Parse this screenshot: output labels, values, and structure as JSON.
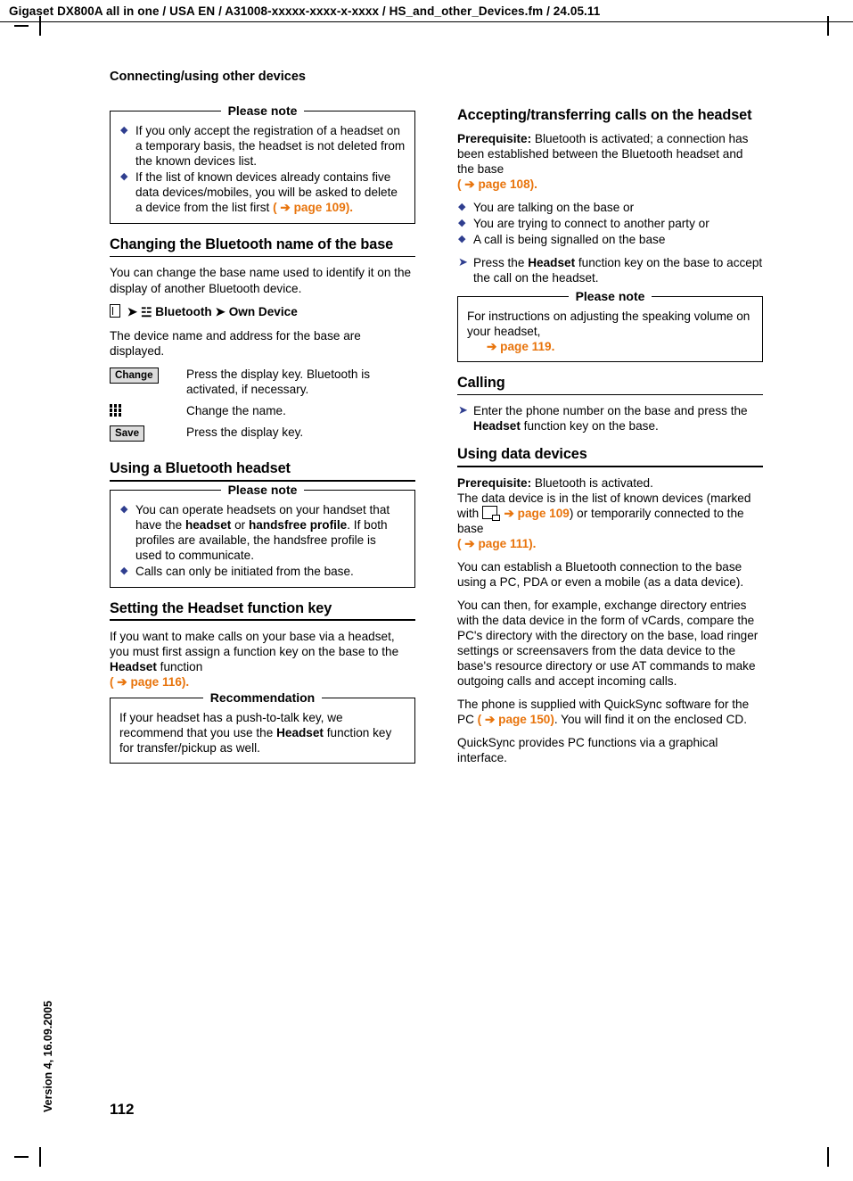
{
  "document": {
    "header": "Gigaset DX800A all in one / USA EN / A31008-xxxxx-xxxx-x-xxxx / HS_and_other_Devices.fm / 24.05.11",
    "running_head": "Connecting/using other devices",
    "page_number": "112",
    "side_version": "Version 4, 16.09.2005",
    "link_color": "#E8740C",
    "bullet_color": "#2F3E8F"
  },
  "left_column": {
    "note1": {
      "title": "Please note",
      "items": [
        "If you only accept the registration of a headset on a temporary basis, the headset is not deleted from the known devices list.",
        "If the list of known devices already contains five data devices/mobiles, you will be asked to delete a device from the list first "
      ],
      "item2_link": "( ➔ page 109)."
    },
    "section1": {
      "heading": "Changing the Bluetooth name of the base",
      "para1": "You can change the base name used to identify it on the display of another Bluetooth device.",
      "menu_path_1": "Bluetooth",
      "menu_path_2": "Own Device",
      "para2": "The device name and address for the base are displayed.",
      "steps": [
        {
          "key": "Change",
          "key_type": "display-key",
          "text": "Press the display key. Bluetooth is activated, if necessary."
        },
        {
          "key": "keypad",
          "key_type": "keypad",
          "text": "Change the name."
        },
        {
          "key": "Save",
          "key_type": "display-key",
          "text": "Press the display key."
        }
      ]
    },
    "section2": {
      "heading": "Using a Bluetooth headset",
      "note": {
        "title": "Please note",
        "item1_a": "You can operate headsets on your handset that have the ",
        "item1_b": "headset",
        "item1_c": " or ",
        "item1_d": "handsfree profile",
        "item1_e": ". If both profiles are available, the handsfree profile is used to communicate.",
        "item2": "Calls can only be initiated from the base."
      }
    },
    "section3": {
      "heading": "Setting the Headset function key",
      "para1_a": "If you want to make calls on your base via a headset, you must first assign a function key on the base to the ",
      "para1_b": "Headset",
      "para1_c": " function",
      "para1_link": "( ➔ page 116).",
      "recommendation": {
        "title": "Recommendation",
        "text_a": "If your headset has a push-to-talk key, we recommend that you use the ",
        "text_b": "Headset",
        "text_c": " function key for transfer/pickup as well."
      }
    }
  },
  "right_column": {
    "section1": {
      "heading": "Accepting/transferring calls on the headset",
      "prereq_label": "Prerequisite:",
      "prereq_text": " Bluetooth is activated; a connection has been established between the Bluetooth headset and the base",
      "prereq_link": "( ➔ page 108).",
      "bullets": [
        "You are talking on the base or",
        "You are trying to connect to another party or",
        "A call is being signalled on the base"
      ],
      "action_a": "Press the ",
      "action_b": "Headset",
      "action_c": " function key on the base to accept the call on the headset.",
      "note": {
        "title": "Please note",
        "text": "For instructions on adjusting the speaking volume on your headset,",
        "link": "➔ page 119."
      }
    },
    "section2": {
      "heading": "Calling",
      "action_a": "Enter the phone number on the base and press the ",
      "action_b": "Headset",
      "action_c": " function key on the base."
    },
    "section3": {
      "heading": "Using data devices",
      "prereq_label": "Prerequisite:",
      "prereq_text": " Bluetooth is activated.",
      "para1_a": "The data device is in the list of known devices (marked with ",
      "para1_link1": "➔  page 109",
      "para1_b": ") or temporarily connected to the base",
      "para1_link2": "( ➔  page 111).",
      "para2": "You can establish a Bluetooth connection to the base using a PC, PDA or even a mobile (as a data device).",
      "para3": "You can then, for example, exchange directory entries with the data device in the form of vCards, compare the PC's directory with the directory on the base, load ringer settings or screensavers from the data device to the base's resource directory or use AT commands to make outgoing calls and accept incoming calls.",
      "para4_a": "The phone is supplied with QuickSync software for the PC ",
      "para4_link": "( ➔  page 150)",
      "para4_b": ". You will find it on the enclosed CD.",
      "para5": "QuickSync provides PC functions via a graphical interface."
    }
  }
}
